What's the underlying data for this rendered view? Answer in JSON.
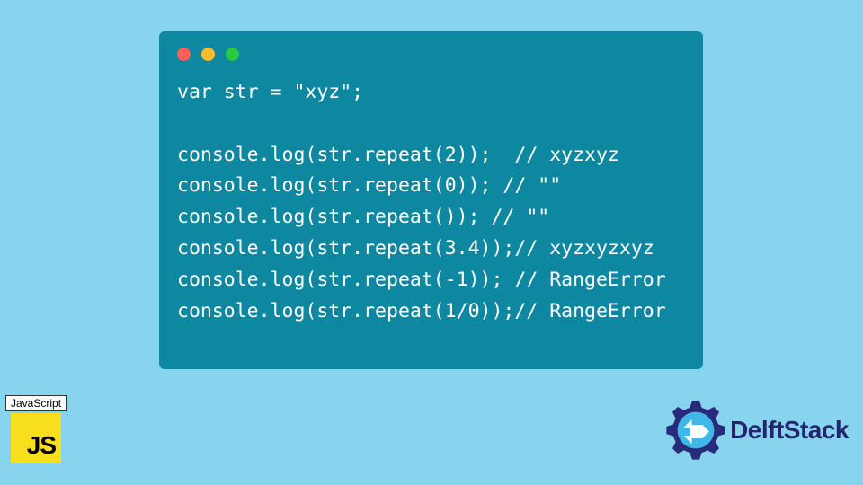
{
  "code": {
    "lines": [
      "var str = \"xyz\";",
      "",
      "console.log(str.repeat(2));  // xyzxyz",
      "console.log(str.repeat(0)); // \"\"",
      "console.log(str.repeat()); // \"\"",
      "console.log(str.repeat(3.4));// xyzxyzxyz",
      "console.log(str.repeat(-1)); // RangeError",
      "console.log(str.repeat(1/0));// RangeError"
    ]
  },
  "badges": {
    "js_label": "JavaScript",
    "js_logo_text": "JS",
    "brand": "DelftStack"
  },
  "colors": {
    "bg": "#87d4ee",
    "window": "#0e87a1",
    "js_yellow": "#f7df1e",
    "brand_blue": "#24246f"
  }
}
